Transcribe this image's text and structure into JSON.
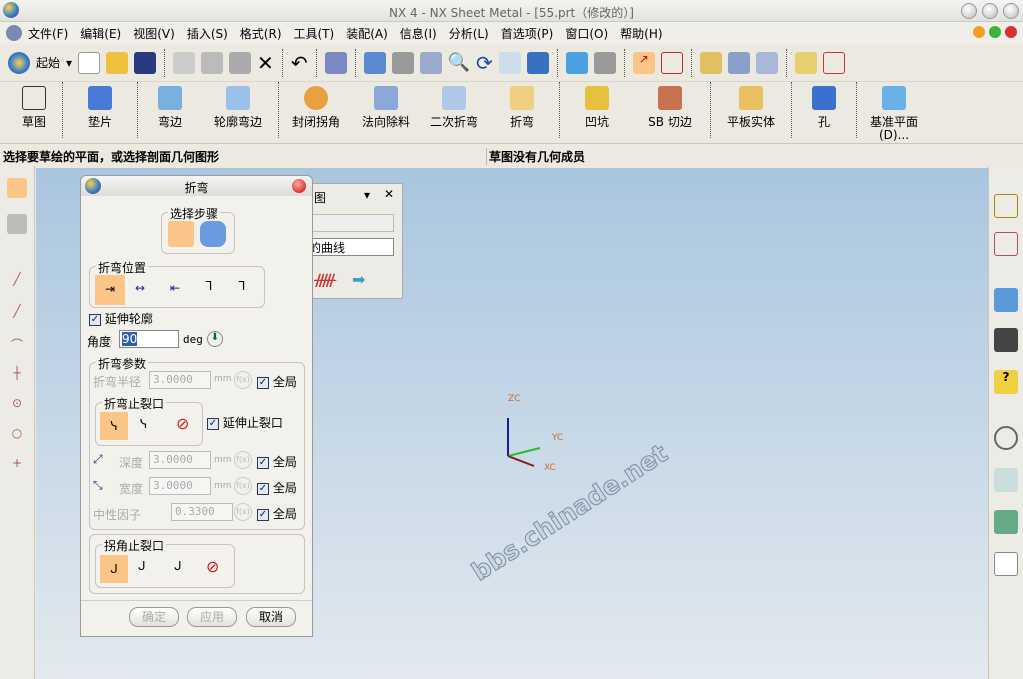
{
  "window": {
    "title": "NX 4 - NX Sheet Metal - [55.prt（修改的）]"
  },
  "menu": [
    "文件(F)",
    "编辑(E)",
    "视图(V)",
    "插入(S)",
    "格式(R)",
    "工具(T)",
    "装配(A)",
    "信息(I)",
    "分析(L)",
    "首选项(P)",
    "窗口(O)",
    "帮助(H)"
  ],
  "toolbar": {
    "start_label": "起始"
  },
  "feature_toolbar": [
    "草图",
    "垫片",
    "弯边",
    "轮廓弯边",
    "封闭拐角",
    "法向除料",
    "二次折弯",
    "折弯",
    "凹坑",
    "SB 切边",
    "平板实体",
    "孔",
    "基准平面(D)..."
  ],
  "status": {
    "prompt": "选择要草绘的平面，或选择剖面几何图形",
    "message": "草图没有几何成员"
  },
  "viewport": {
    "watermark": "bbs.chinade.net",
    "axes": {
      "z": "ZC",
      "y": "YC",
      "x": "XC"
    },
    "colors": {
      "x": "#8b1a1a",
      "y": "#22c022",
      "z": "#1a1aa0"
    }
  },
  "back_panel": {
    "title_fragment": "图",
    "dropdown_value": "的曲线"
  },
  "dialog": {
    "title": "折弯",
    "steps_label": "选择步骤",
    "position_label": "折弯位置",
    "extend_profile": "延伸轮廓",
    "angle_label": "角度",
    "angle_value": "90",
    "angle_unit": "deg",
    "params_label": "折弯参数",
    "radius_label": "折弯半径",
    "radius_value": "3.0000",
    "unit": "mm",
    "global": "全局",
    "relief_label": "折弯止裂口",
    "extend_relief": "延伸止裂口",
    "depth_label": "深度",
    "depth_value": "3.0000",
    "width_label": "宽度",
    "width_value": "3.0000",
    "neutral_label": "中性因子",
    "neutral_value": "0.3300",
    "corner_label": "拐角止裂口",
    "ok": "确定",
    "apply": "应用",
    "cancel": "取消"
  }
}
